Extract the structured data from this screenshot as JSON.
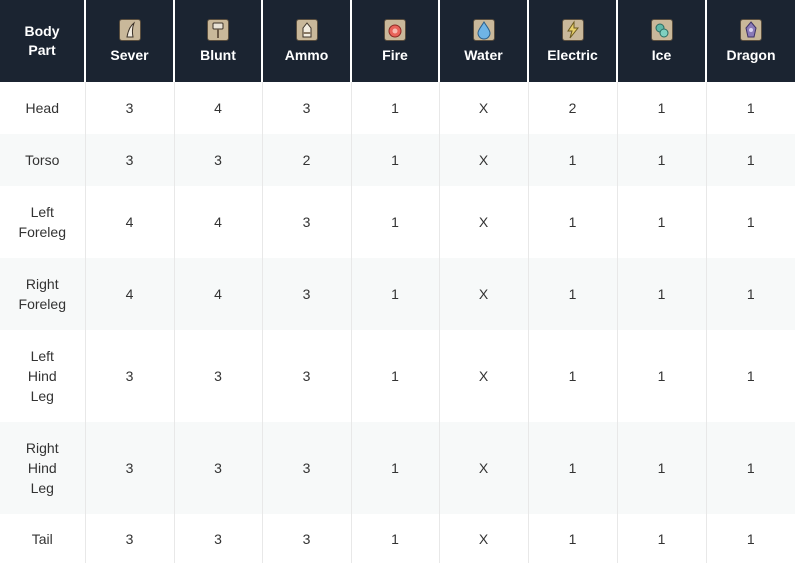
{
  "header": {
    "part_line1": "Body",
    "part_line2": "Part",
    "columns": [
      {
        "label": "Sever",
        "icon": "sever-icon",
        "bg": "#c9b89a"
      },
      {
        "label": "Blunt",
        "icon": "blunt-icon",
        "bg": "#c9b89a"
      },
      {
        "label": "Ammo",
        "icon": "ammo-icon",
        "bg": "#c9b89a"
      },
      {
        "label": "Fire",
        "icon": "fire-icon",
        "bg": "#c9b89a"
      },
      {
        "label": "Water",
        "icon": "water-icon",
        "bg": "#c9b89a"
      },
      {
        "label": "Electric",
        "icon": "electric-icon",
        "bg": "#c9b89a"
      },
      {
        "label": "Ice",
        "icon": "ice-icon",
        "bg": "#c9b89a"
      },
      {
        "label": "Dragon",
        "icon": "dragon-icon",
        "bg": "#c9b89a"
      }
    ]
  },
  "colors": {
    "header_bg": "#1b2431",
    "row_alt_bg": "#f7f9f9"
  },
  "rows": [
    {
      "part": [
        "Head"
      ],
      "values": [
        "3",
        "4",
        "3",
        "1",
        "X",
        "2",
        "1",
        "1"
      ]
    },
    {
      "part": [
        "Torso"
      ],
      "values": [
        "3",
        "3",
        "2",
        "1",
        "X",
        "1",
        "1",
        "1"
      ]
    },
    {
      "part": [
        "Left",
        "Foreleg"
      ],
      "values": [
        "4",
        "4",
        "3",
        "1",
        "X",
        "1",
        "1",
        "1"
      ]
    },
    {
      "part": [
        "Right",
        "Foreleg"
      ],
      "values": [
        "4",
        "4",
        "3",
        "1",
        "X",
        "1",
        "1",
        "1"
      ]
    },
    {
      "part": [
        "Left",
        "Hind",
        "Leg"
      ],
      "values": [
        "3",
        "3",
        "3",
        "1",
        "X",
        "1",
        "1",
        "1"
      ]
    },
    {
      "part": [
        "Right",
        "Hind",
        "Leg"
      ],
      "values": [
        "3",
        "3",
        "3",
        "1",
        "X",
        "1",
        "1",
        "1"
      ]
    },
    {
      "part": [
        "Tail"
      ],
      "values": [
        "3",
        "3",
        "3",
        "1",
        "X",
        "1",
        "1",
        "1"
      ]
    }
  ]
}
